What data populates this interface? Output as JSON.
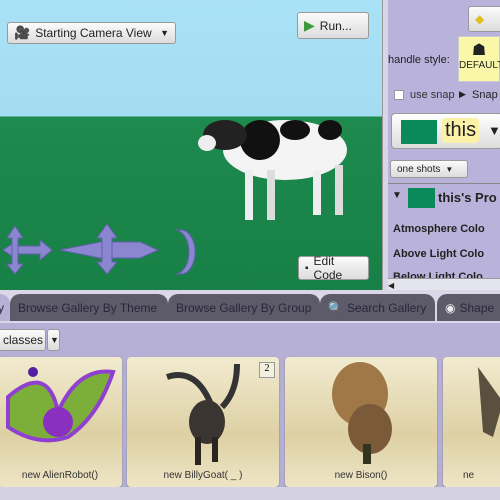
{
  "scene": {
    "camera_view": "Starting Camera View",
    "run_label": "Run...",
    "edit_code_label": "Edit Code"
  },
  "right_panel": {
    "handle_style_label": "handle style:",
    "handle_default": "DEFAULT",
    "use_snap": "use snap",
    "snap_label": "Snap",
    "selected_object": "this",
    "one_shots": "one shots",
    "properties_header": "this's Pro",
    "properties": [
      "Atmosphere Colo",
      "Above Light Colo",
      "Below Light Colo"
    ]
  },
  "gallery": {
    "tabs": [
      "y",
      "Browse Gallery By Theme",
      "Browse Gallery By Group",
      "Search Gallery",
      "Shape"
    ],
    "classes_dropdown": "classes",
    "cards": [
      {
        "label": "new AlienRobot()"
      },
      {
        "label": "new BillyGoat( _ )",
        "badge": "2"
      },
      {
        "label": "new Bison()"
      },
      {
        "label": "ne"
      }
    ]
  },
  "colors": {
    "sky": "#a9e2f6",
    "ground": "#1e8a4e",
    "panel": "#b6b0d6",
    "tab": "#5d5a6a"
  }
}
